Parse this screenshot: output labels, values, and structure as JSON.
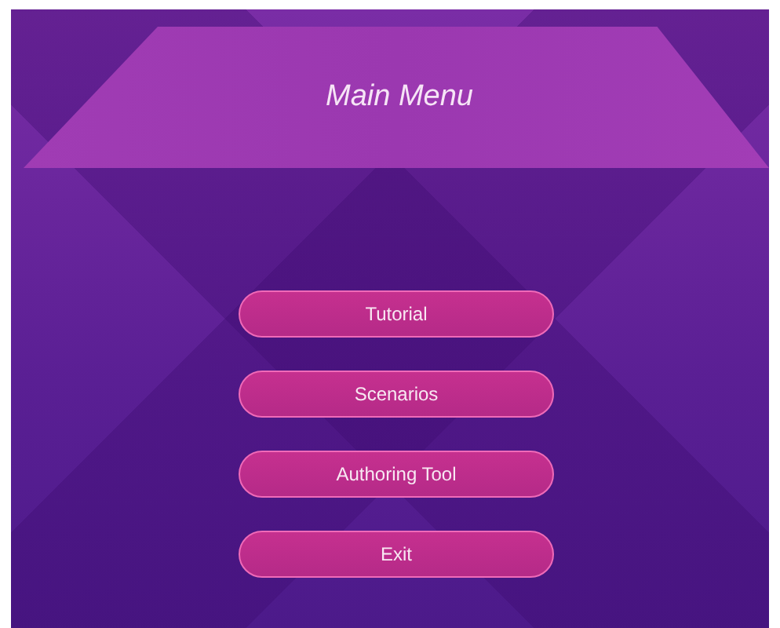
{
  "title": "Main Menu",
  "buttons": [
    "Tutorial",
    "Scenarios",
    "Authoring Tool",
    "Exit"
  ]
}
